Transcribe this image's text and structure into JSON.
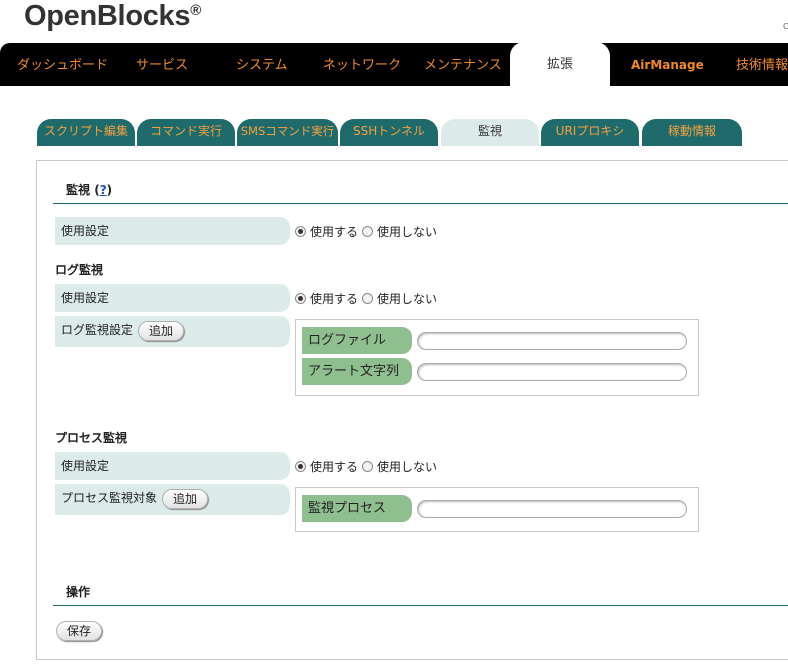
{
  "brand": {
    "name": "OpenBlocks",
    "reg": "®",
    "corner_mark": "C"
  },
  "topnav": [
    {
      "label": "ダッシュボード",
      "active": false
    },
    {
      "label": "サービス",
      "active": false
    },
    {
      "label": "システム",
      "active": false
    },
    {
      "label": "ネットワーク",
      "active": false
    },
    {
      "label": "メンテナンス",
      "active": false
    },
    {
      "label": "拡張",
      "active": true
    },
    {
      "label": "AirManage",
      "active": false
    },
    {
      "label": "技術情報",
      "active": false
    }
  ],
  "subtabs": [
    {
      "label": "スクリプト編集",
      "active": false
    },
    {
      "label": "コマンド実行",
      "active": false
    },
    {
      "label": "SMSコマンド実行",
      "active": false
    },
    {
      "label": "SSHトンネル",
      "active": false
    },
    {
      "label": "監視",
      "active": true
    },
    {
      "label": "URIプロキシ",
      "active": false
    },
    {
      "label": "稼動情報",
      "active": false
    }
  ],
  "monitor": {
    "title": "監視",
    "help_open": "(",
    "help": "?",
    "help_close": ")",
    "usage_label": "使用設定",
    "radio_on": "使用する",
    "radio_off": "使用しない",
    "usage_value": "使用する"
  },
  "log_monitor": {
    "title": "ログ監視",
    "usage_label": "使用設定",
    "usage_value": "使用する",
    "setting_label": "ログ監視設定",
    "add_button": "追加",
    "fields": [
      {
        "label": "ログファイル",
        "value": ""
      },
      {
        "label": "アラート文字列",
        "value": ""
      }
    ]
  },
  "process_monitor": {
    "title": "プロセス監視",
    "usage_label": "使用設定",
    "usage_value": "使用する",
    "target_label": "プロセス監視対象",
    "add_button": "追加",
    "fields": [
      {
        "label": "監視プロセス",
        "value": ""
      }
    ]
  },
  "operations": {
    "title": "操作",
    "save_button": "保存"
  },
  "colors": {
    "nav_bg": "#000000",
    "nav_text": "#f08a2c",
    "tab_bg": "#1f6b6b",
    "tab_text": "#f5a040",
    "tab_active_bg": "#dcebea",
    "label_bg": "#dcebea",
    "field_label_bg": "#8fbf8f",
    "rule": "#1f6b6b"
  }
}
